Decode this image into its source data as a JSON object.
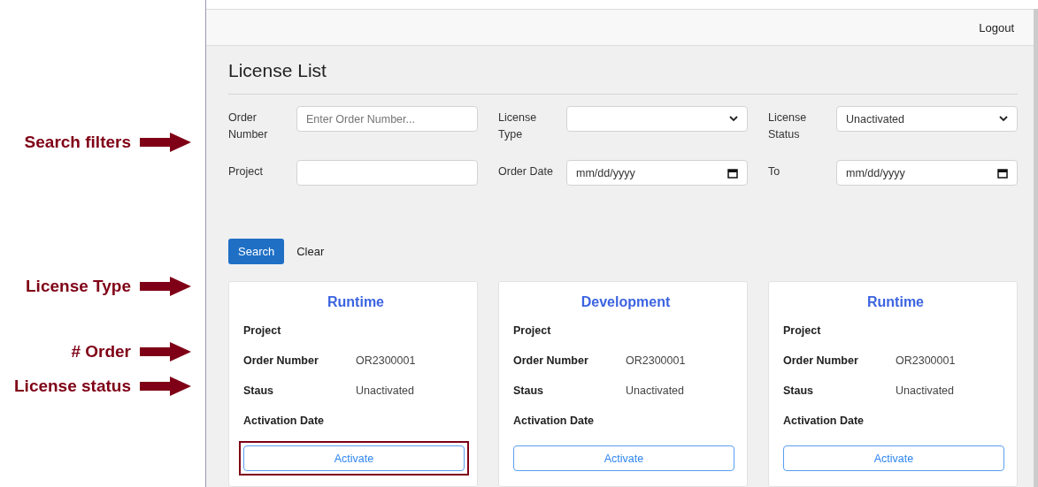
{
  "annotations": [
    {
      "text": "Search filters"
    },
    {
      "text": "License Type"
    },
    {
      "text": "# Order"
    },
    {
      "text": "License status"
    }
  ],
  "header": {
    "logout": "Logout"
  },
  "page_title": "License List",
  "filters": [
    {
      "label": "Order Number",
      "kind": "text",
      "placeholder": "Enter Order Number..."
    },
    {
      "label": "License Type",
      "kind": "select"
    },
    {
      "label": "License Status",
      "kind": "select",
      "value": "Unactivated"
    },
    {
      "label": "Project",
      "kind": "text"
    },
    {
      "label": "Order Date",
      "kind": "date",
      "placeholder": "mm/dd/yyyy"
    },
    {
      "label": "To",
      "kind": "date",
      "placeholder": "mm/dd/yyyy"
    }
  ],
  "actions": {
    "search": "Search",
    "clear": "Clear"
  },
  "cards": [
    {
      "type": "Runtime",
      "fields": [
        {
          "label": "Project"
        },
        {
          "label": "Order Number",
          "value": "OR2300001"
        },
        {
          "label": "Staus",
          "value": "Unactivated"
        },
        {
          "label": "Activation Date"
        }
      ],
      "button": "Activate",
      "highlighted": true
    },
    {
      "type": "Development",
      "fields": [
        {
          "label": "Project"
        },
        {
          "label": "Order Number",
          "value": "OR2300001"
        },
        {
          "label": "Staus",
          "value": "Unactivated"
        },
        {
          "label": "Activation Date"
        }
      ],
      "button": "Activate",
      "highlighted": false
    },
    {
      "type": "Runtime",
      "fields": [
        {
          "label": "Project"
        },
        {
          "label": "Order Number",
          "value": "OR2300001"
        },
        {
          "label": "Staus",
          "value": "Unactivated"
        },
        {
          "label": "Activation Date"
        }
      ],
      "button": "Activate",
      "highlighted": false
    }
  ]
}
